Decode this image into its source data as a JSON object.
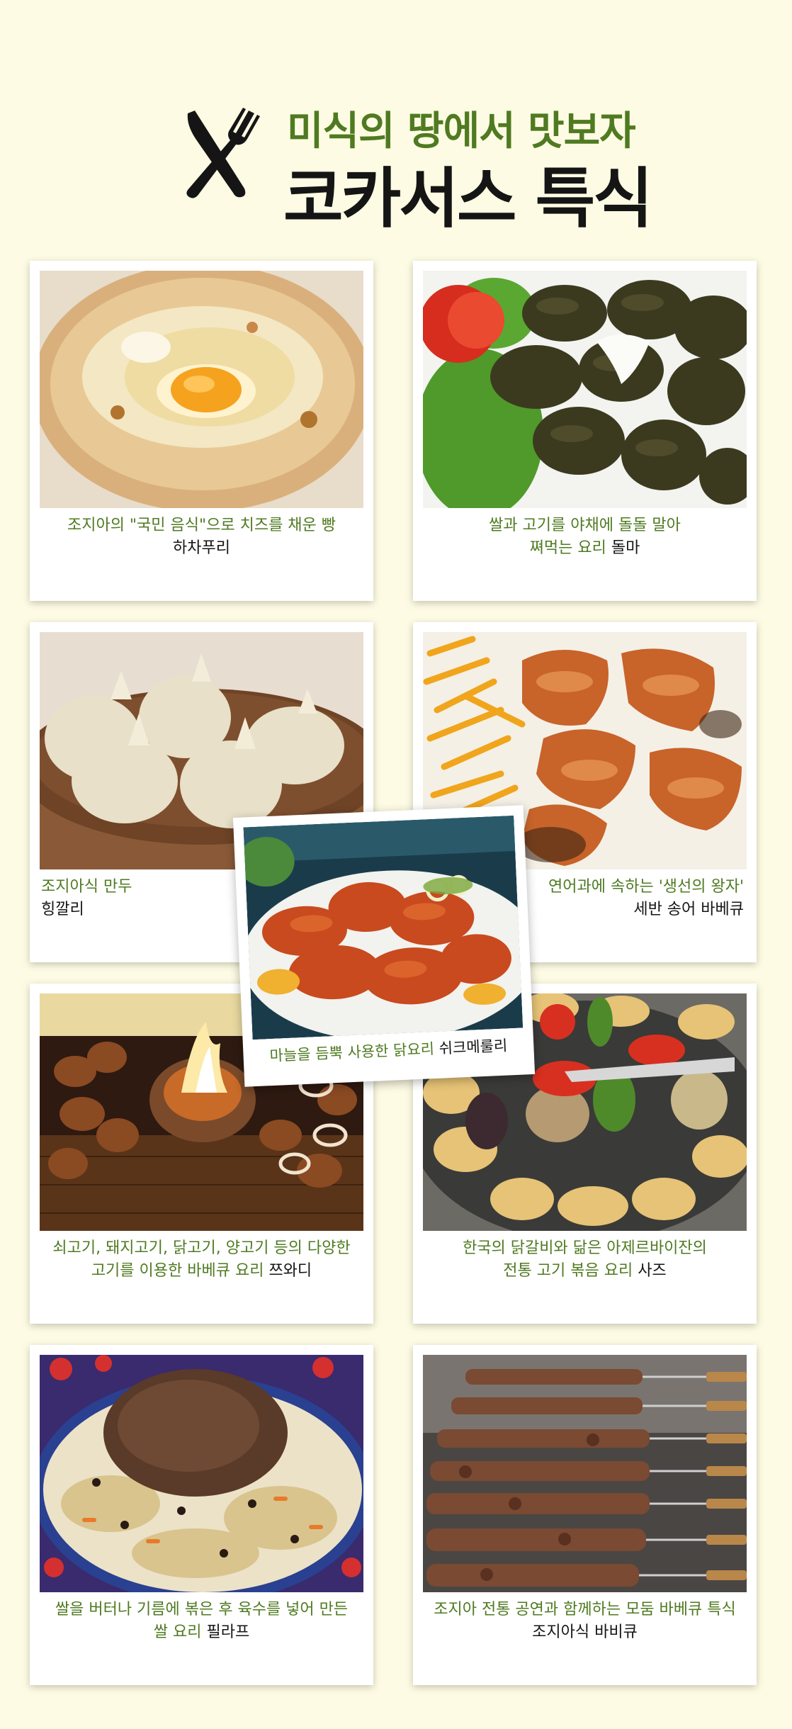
{
  "header": {
    "subtitle": "미식의 땅에서 맛보자",
    "title": "코카서스 특식",
    "icon": "fork-knife-icon"
  },
  "colors": {
    "background": "#fdfbe3",
    "accent_green": "#4f7a21",
    "text_dark": "#151515"
  },
  "cards": [
    {
      "line1": "조지아의 \"국민 음식\"으로 치즈를 채운 빵",
      "line2_prefix": "",
      "dish": "하차푸리"
    },
    {
      "line1": "쌀과 고기를 야채에 돌돌 말아",
      "line2_prefix": "쪄먹는 요리 ",
      "dish": "돌마"
    },
    {
      "line1": "조지아식 만두",
      "line2_prefix": "",
      "dish": "힝깔리"
    },
    {
      "line1": "연어과에 속하는 '생선의 왕자'",
      "line2_prefix": "",
      "dish": "세반 송어 바베큐"
    },
    {
      "line1": "마늘을 듬뿍 사용한 닭요리 ",
      "line2_prefix": "",
      "dish": "쉬크메룰리"
    },
    {
      "line1": "쇠고기, 돼지고기, 닭고기, 양고기 등의 다양한",
      "line2_prefix": "고기를 이용한 바베큐 요리 ",
      "dish": "쯔와디"
    },
    {
      "line1": "한국의 닭갈비와 닮은 아제르바이잔의",
      "line2_prefix": "전통 고기 볶음 요리 ",
      "dish": "사즈"
    },
    {
      "line1": "쌀을 버터나 기름에 볶은 후 육수를 넣어 만든",
      "line2_prefix": "쌀 요리 ",
      "dish": "필라프"
    },
    {
      "line1": "조지아 전통 공연과 함께하는 모둠 바베큐 특식",
      "line2_prefix": "",
      "dish": "조지아식 바비큐"
    }
  ]
}
